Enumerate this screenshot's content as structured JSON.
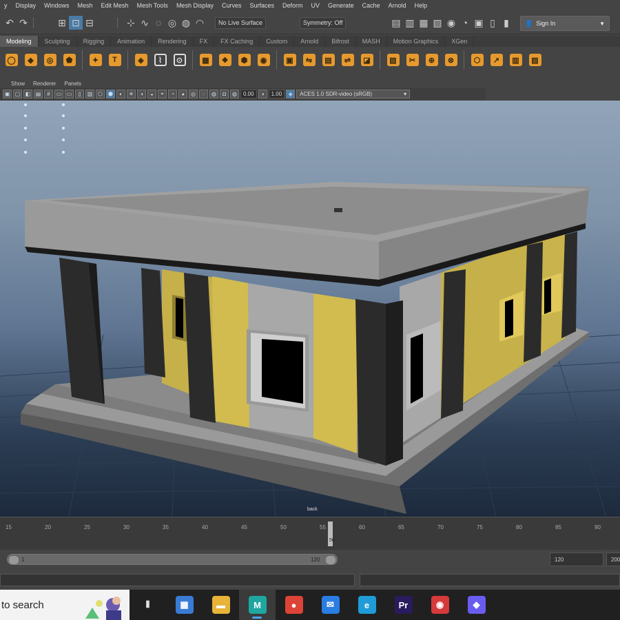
{
  "menubar": {
    "items": [
      "y",
      "Display",
      "Windows",
      "Mesh",
      "Edit Mesh",
      "Mesh Tools",
      "Mesh Display",
      "Curves",
      "Surfaces",
      "Deform",
      "UV",
      "Generate",
      "Cache",
      "Arnold",
      "Help"
    ]
  },
  "statusline": {
    "live_surface": "No Live Surface",
    "symmetry": "Symmetry: Off",
    "sign_in": "Sign In"
  },
  "shelf_tabs": {
    "items": [
      "Modeling",
      "Sculpting",
      "Rigging",
      "Animation",
      "Rendering",
      "FX",
      "FX Caching",
      "Custom",
      "Arnold",
      "Bifrost",
      "MASH",
      "Motion Graphics",
      "XGen"
    ],
    "active": "Modeling"
  },
  "shelf": {
    "icons": [
      "poly-sphere-icon",
      "poly-cube-icon",
      "poly-torus-icon",
      "poly-platonic-icon",
      "super-shape-icon",
      "type-text-icon",
      "svg-icon",
      "sweep-mesh-icon",
      "snap-icon",
      "combine-icon",
      "separate-icon",
      "extract-icon",
      "smooth-icon",
      "booleans-icon",
      "mirror-icon",
      "extrude-icon",
      "bridge-icon",
      "bevel-icon",
      "append-icon",
      "multi-cut-icon",
      "target-weld-icon",
      "merge-icon",
      "quad-draw-icon",
      "edit-normals-icon",
      "uv-editor-icon",
      "planar-map-icon"
    ]
  },
  "panel_menu": {
    "items": [
      "Show",
      "Renderer",
      "Panels"
    ]
  },
  "panel_toolbar": {
    "exposure": "0.00",
    "gamma": "1.00",
    "color_space": "ACES 1.0 SDR-video (sRGB)"
  },
  "viewport": {
    "camera_label": "back",
    "colors": {
      "roof": "#8f8f8f",
      "column": "#2b2b2b",
      "wall_yellow": "#c6b04a",
      "wall_gray": "#a8a8a8",
      "window_opening": "#000000",
      "floor": "#8a8a8a"
    }
  },
  "timeslider": {
    "ticks": [
      "15",
      "20",
      "25",
      "30",
      "35",
      "40",
      "45",
      "50",
      "55",
      "60",
      "65",
      "70",
      "75",
      "80",
      "85",
      "90"
    ],
    "current_frame": "56"
  },
  "range": {
    "start": "1",
    "end": "120",
    "end_field": "120",
    "max_field": "200"
  },
  "taskbar": {
    "search_text": "to search",
    "apps": [
      {
        "name": "task-view",
        "label": "⫴",
        "color": "transparent"
      },
      {
        "name": "microsoft-store",
        "label": "▦",
        "color": "#3a7bd5"
      },
      {
        "name": "file-explorer",
        "label": "▬",
        "color": "#e8b339"
      },
      {
        "name": "maya",
        "label": "M",
        "color": "#1fa6a0"
      },
      {
        "name": "chrome",
        "label": "●",
        "color": "#db4437"
      },
      {
        "name": "mail",
        "label": "✉",
        "color": "#2a7de1"
      },
      {
        "name": "edge",
        "label": "e",
        "color": "#1f9bd7"
      },
      {
        "name": "premiere-pro",
        "label": "Pr",
        "color": "#2a1a5e"
      },
      {
        "name": "screen-recorder",
        "label": "◉",
        "color": "#d63a3a"
      },
      {
        "name": "copilot",
        "label": "◆",
        "color": "#6a5cf0"
      }
    ]
  }
}
